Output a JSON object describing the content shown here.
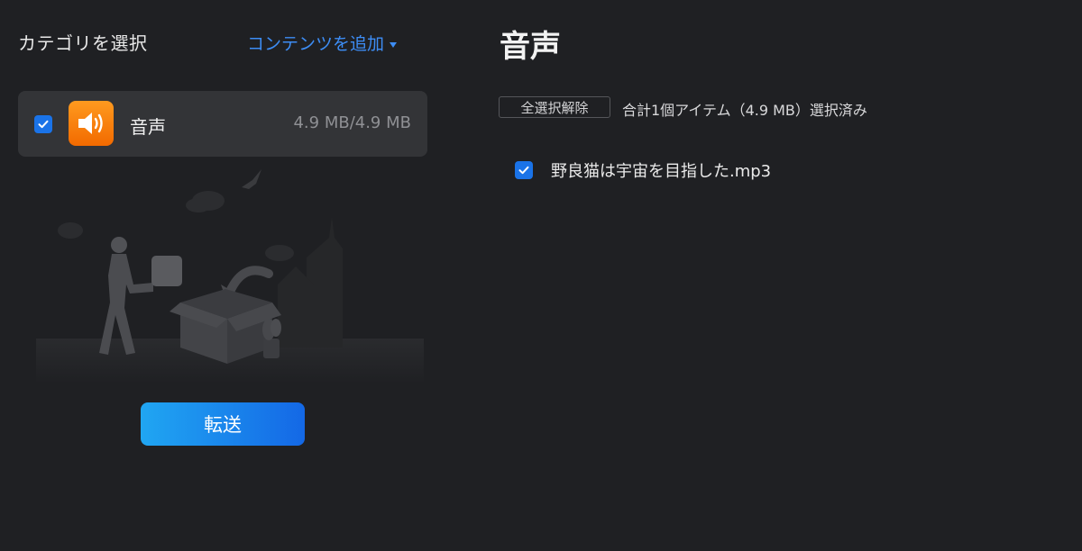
{
  "left_panel": {
    "title": "カテゴリを選択",
    "add_content_label": "コンテンツを追加",
    "categories": [
      {
        "label": "音声",
        "size": "4.9 MB/4.9 MB",
        "checked": true,
        "icon": "speaker-icon",
        "icon_color": "#f27a05"
      }
    ],
    "transfer_label": "転送"
  },
  "right_panel": {
    "title": "音声",
    "deselect_all_label": "全選択解除",
    "summary": "合計1個アイテム（4.9 MB）選択済み",
    "files": [
      {
        "name": "野良猫は宇宙を目指した.mp3",
        "checked": true
      }
    ]
  },
  "colors": {
    "background": "#1f2023",
    "accent": "#3d8df5",
    "checkbox": "#1a73e8",
    "card": "#333437"
  }
}
